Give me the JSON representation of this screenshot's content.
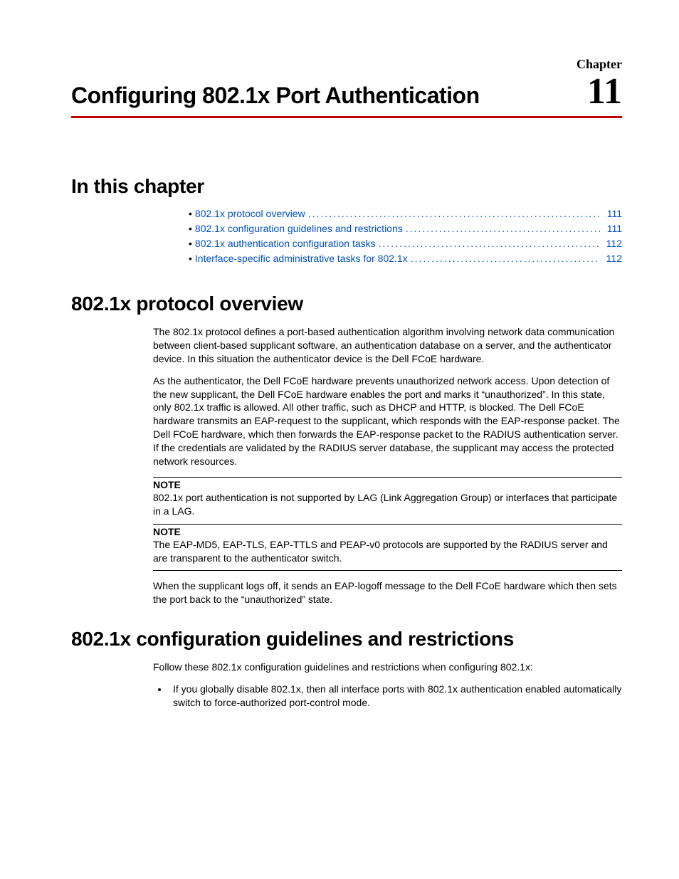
{
  "chapter_label": "Chapter",
  "chapter_number": "11",
  "chapter_title": "Configuring 802.1x Port Authentication",
  "sections": {
    "in_this_chapter": "In this chapter",
    "overview": "802.1x protocol overview",
    "guidelines": "802.1x configuration guidelines and restrictions"
  },
  "toc": [
    {
      "label": "802.1x protocol overview",
      "page": "111"
    },
    {
      "label": "802.1x configuration guidelines and restrictions",
      "page": "111"
    },
    {
      "label": "802.1x authentication configuration tasks",
      "page": "112"
    },
    {
      "label": "Interface-specific administrative tasks for 802.1x",
      "page": "112"
    }
  ],
  "overview_paragraphs": {
    "p1": "The 802.1x protocol defines a port-based authentication algorithm involving network data communication between client-based supplicant software, an authentication database on a server, and the authenticator device. In this situation the authenticator device is the Dell FCoE hardware.",
    "p2": "As the authenticator, the Dell FCoE hardware prevents unauthorized network access. Upon detection of the new supplicant, the Dell FCoE hardware enables the port and marks it “unauthorized”. In this state, only 802.1x traffic is allowed. All other traffic, such as DHCP and HTTP, is blocked. The Dell FCoE hardware transmits an EAP-request to the supplicant, which responds with the EAP-response packet. The Dell FCoE hardware, which then forwards the EAP-response packet to the RADIUS authentication server. If the credentials are validated by the RADIUS server database, the supplicant may access the protected network resources.",
    "p3": "When the supplicant logs off, it sends an EAP-logoff message to the Dell FCoE hardware which then sets the port back to the “unauthorized” state."
  },
  "notes": {
    "label": "NOTE",
    "n1": "802.1x port authentication is not supported by LAG (Link Aggregation Group) or interfaces that participate in a LAG.",
    "n2": "The EAP-MD5, EAP-TLS, EAP-TTLS and PEAP-v0 protocols are supported by the RADIUS server and are transparent to the authenticator switch."
  },
  "guidelines_body": {
    "intro": "Follow these 802.1x configuration guidelines and restrictions when configuring 802.1x:",
    "bullet1": "If you globally disable 802.1x, then all interface ports with 802.1x authentication enabled automatically switch to force-authorized port-control mode."
  }
}
